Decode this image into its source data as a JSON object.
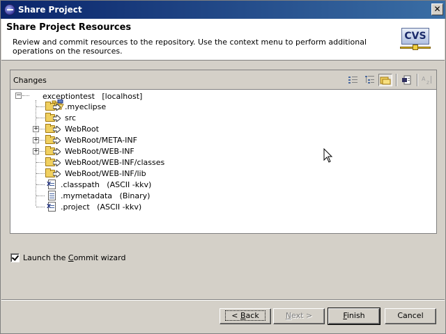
{
  "window": {
    "title": "Share Project",
    "close_label": "✕"
  },
  "banner": {
    "heading": "Share Project Resources",
    "description": "Review and commit resources to the repository. Use the context menu to perform additional operations on the resources.",
    "logo_text": "CVS"
  },
  "changes": {
    "label": "Changes",
    "toolbar": [
      {
        "name": "flat-mode-icon",
        "active": false
      },
      {
        "name": "tree-mode-icon",
        "active": false
      },
      {
        "name": "compressed-folders-icon",
        "active": true
      },
      {
        "name": "show-outgoing-icon",
        "active": false
      },
      {
        "name": "sort-icon",
        "active": false,
        "disabled": true
      }
    ],
    "tree": {
      "root": {
        "label": "exceptiontest   [localhost]",
        "expanded": true
      },
      "items": [
        {
          "label": ".myeclipse",
          "kind": "folder",
          "expandable": false
        },
        {
          "label": "src",
          "kind": "folder",
          "expandable": false
        },
        {
          "label": "WebRoot",
          "kind": "folder",
          "expandable": true
        },
        {
          "label": "WebRoot/META-INF",
          "kind": "folder",
          "expandable": true
        },
        {
          "label": "WebRoot/WEB-INF",
          "kind": "folder",
          "expandable": true
        },
        {
          "label": "WebRoot/WEB-INF/classes",
          "kind": "folder",
          "expandable": false
        },
        {
          "label": "WebRoot/WEB-INF/lib",
          "kind": "folder",
          "expandable": false
        },
        {
          "label": ".classpath   (ASCII -kkv)",
          "kind": "xml-file",
          "expandable": false
        },
        {
          "label": ".mymetadata   (Binary)",
          "kind": "file",
          "expandable": false
        },
        {
          "label": ".project   (ASCII -kkv)",
          "kind": "xml-file",
          "expandable": false
        }
      ]
    }
  },
  "options": {
    "launch_commit_prefix": "Launch the ",
    "launch_commit_mnemonic": "C",
    "launch_commit_suffix": "ommit wizard",
    "checked": true
  },
  "buttons": {
    "back_prefix": "< ",
    "back_mnemonic": "B",
    "back_suffix": "ack",
    "next_prefix": "",
    "next_mnemonic": "N",
    "next_suffix": "ext >",
    "finish_prefix": "",
    "finish_mnemonic": "F",
    "finish_suffix": "inish",
    "cancel": "Cancel"
  },
  "colors": {
    "titlebar_start": "#0a246a",
    "titlebar_end": "#3a6ea5",
    "dialog_bg": "#d4d0c8",
    "folder": "#f0d060"
  }
}
